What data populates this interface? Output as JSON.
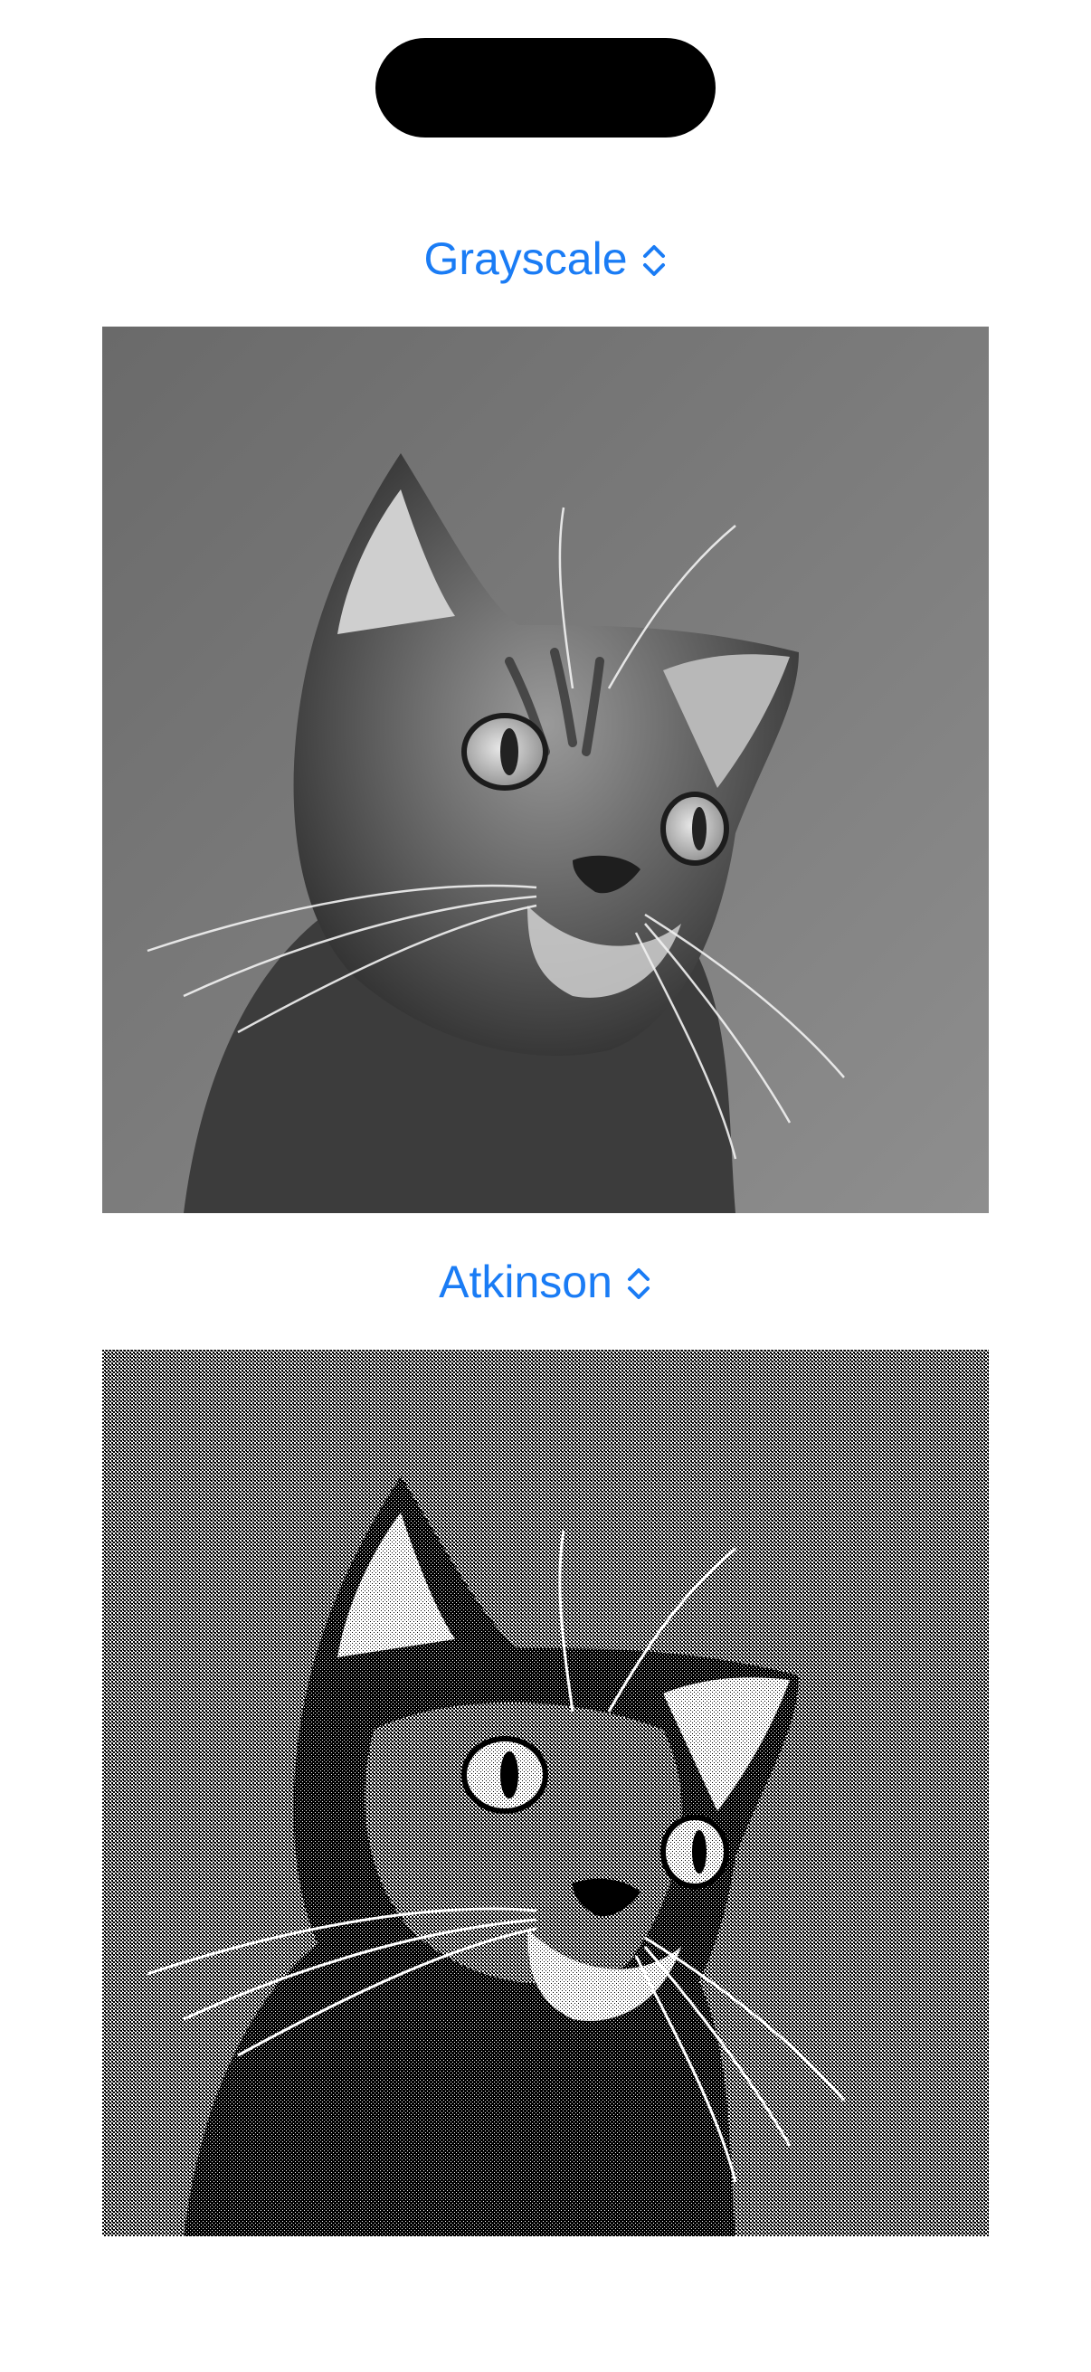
{
  "filter_pickers": [
    {
      "label": "Grayscale",
      "icon": "chevron-up-down-icon",
      "accent": "#1a7cf5"
    },
    {
      "label": "Atkinson",
      "icon": "chevron-up-down-icon",
      "accent": "#1a7cf5"
    }
  ],
  "images": [
    {
      "subject": "cat-photo",
      "filter": "grayscale"
    },
    {
      "subject": "cat-photo",
      "filter": "atkinson-dither"
    }
  ]
}
